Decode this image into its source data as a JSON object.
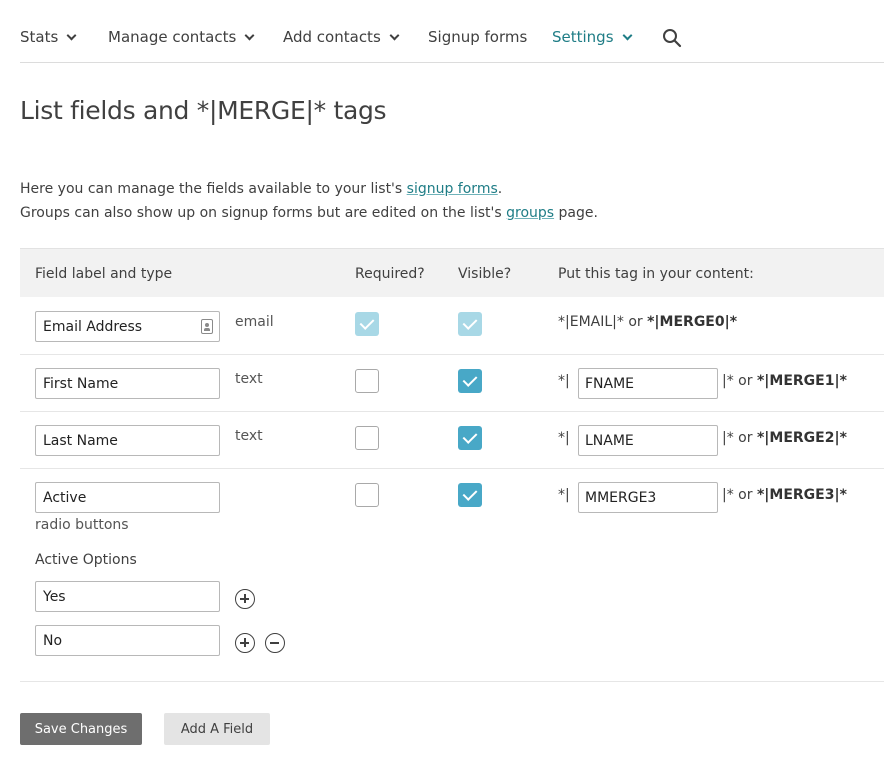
{
  "nav": {
    "items": [
      {
        "label": "Stats",
        "has_dropdown": true
      },
      {
        "label": "Manage contacts",
        "has_dropdown": true
      },
      {
        "label": "Add contacts",
        "has_dropdown": true
      },
      {
        "label": "Signup forms",
        "has_dropdown": false
      },
      {
        "label": "Settings",
        "has_dropdown": true,
        "active": true
      }
    ],
    "search_icon": "search-icon"
  },
  "page": {
    "title": "List fields and *|MERGE|* tags",
    "intro_line1_prefix": "Here you can manage the fields available to your list's ",
    "intro_line1_link": "signup forms",
    "intro_line1_suffix": ".",
    "intro_line2_prefix": "Groups can also show up on signup forms but are edited on the list's ",
    "intro_line2_link": "groups",
    "intro_line2_suffix": " page."
  },
  "table": {
    "headers": {
      "field": "Field label and type",
      "required": "Required?",
      "visible": "Visible?",
      "tag": "Put this tag in your content:"
    },
    "rows": [
      {
        "label": "Email Address",
        "type": "email",
        "required": true,
        "visible": true,
        "disabled": true,
        "tag_full": "*|EMAIL|*",
        "or": " or ",
        "merge": "*|MERGE0|*"
      },
      {
        "label": "First Name",
        "type": "text",
        "required": false,
        "visible": true,
        "tag_prefix": "*|",
        "tag": "FNAME",
        "tag_suffix": "|* or ",
        "merge": "*|MERGE1|*"
      },
      {
        "label": "Last Name",
        "type": "text",
        "required": false,
        "visible": true,
        "tag_prefix": "*|",
        "tag": "LNAME",
        "tag_suffix": "|* or ",
        "merge": "*|MERGE2|*"
      },
      {
        "label": "Active",
        "type": "radio buttons",
        "required": false,
        "visible": true,
        "tag_prefix": "*|",
        "tag": "MMERGE3",
        "tag_suffix": "|* or ",
        "merge": "*|MERGE3|*",
        "options_heading": "Active Options",
        "options": [
          "Yes",
          "No"
        ]
      }
    ]
  },
  "buttons": {
    "save": "Save Changes",
    "add_field": "Add A Field"
  },
  "colors": {
    "accent": "#1f7d86",
    "checkbox_on": "#48a8c7",
    "checkbox_disabled": "#a8d8e6",
    "primary_button": "#6e6e6e"
  }
}
